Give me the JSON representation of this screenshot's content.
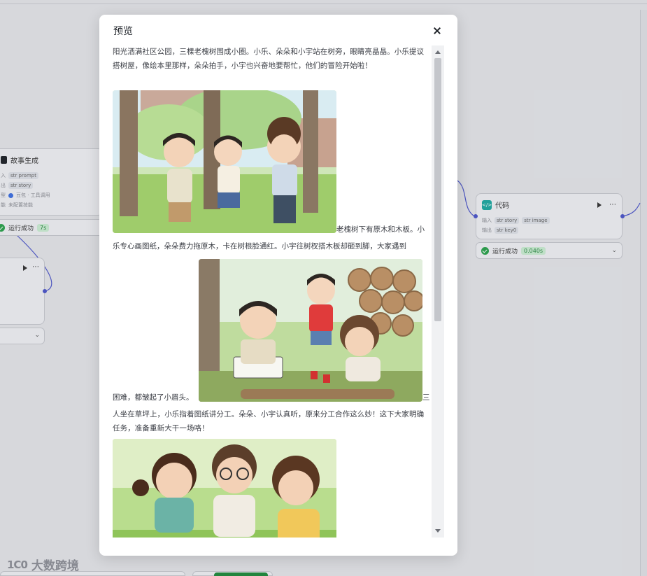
{
  "modal": {
    "title": "预览",
    "close_label": "×"
  },
  "story": {
    "para1": "阳光洒满社区公园，三棵老槐树围成小圈。小乐、朵朵和小宇站在树旁，眼睛亮晶晶。小乐提议搭树屋，像绘本里那样，朵朵拍手，小宇也兴奋地要帮忙，他们的冒险开始啦！",
    "para2_start": "老槐树下有原木和木板。小",
    "para2_line2": "乐专心画图纸，朵朵费力拖原木，卡在树根脸通红。小宇往树杈搭木板却砸到脚，大家遇到",
    "para2_end": "困难，都皱起了小眉头。",
    "para3_start": "三",
    "para3_rest": "人坐在草坪上，小乐指着图纸讲分工。朵朵、小宇认真听，原来分工合作这么妙！这下大家明确任务，准备重新大干一场咯！"
  },
  "canvas": {
    "node_left": {
      "title": "故事生成",
      "input_label": "入",
      "input_var": "prompt",
      "output_label": "出",
      "output_var": "story",
      "model_label": "型",
      "model_value": "豆包 · 工具调用",
      "extra_label": "能",
      "extra_value": "未配置技能"
    },
    "status_left": {
      "text": "运行成功",
      "time": "7s"
    },
    "node_code": {
      "title": "代码",
      "input_label": "输入",
      "input_var1": "story",
      "input_var2": "image",
      "output_label": "输出",
      "output_var": "key0"
    },
    "status_code": {
      "text": "运行成功",
      "time": "0.040s"
    },
    "chip_type": "str"
  },
  "watermark": {
    "logo": "1C0",
    "text": "大数跨境"
  },
  "colors": {
    "accent": "#4b55c8",
    "success": "#2aa14b",
    "code_icon": "#1fa8a0"
  }
}
